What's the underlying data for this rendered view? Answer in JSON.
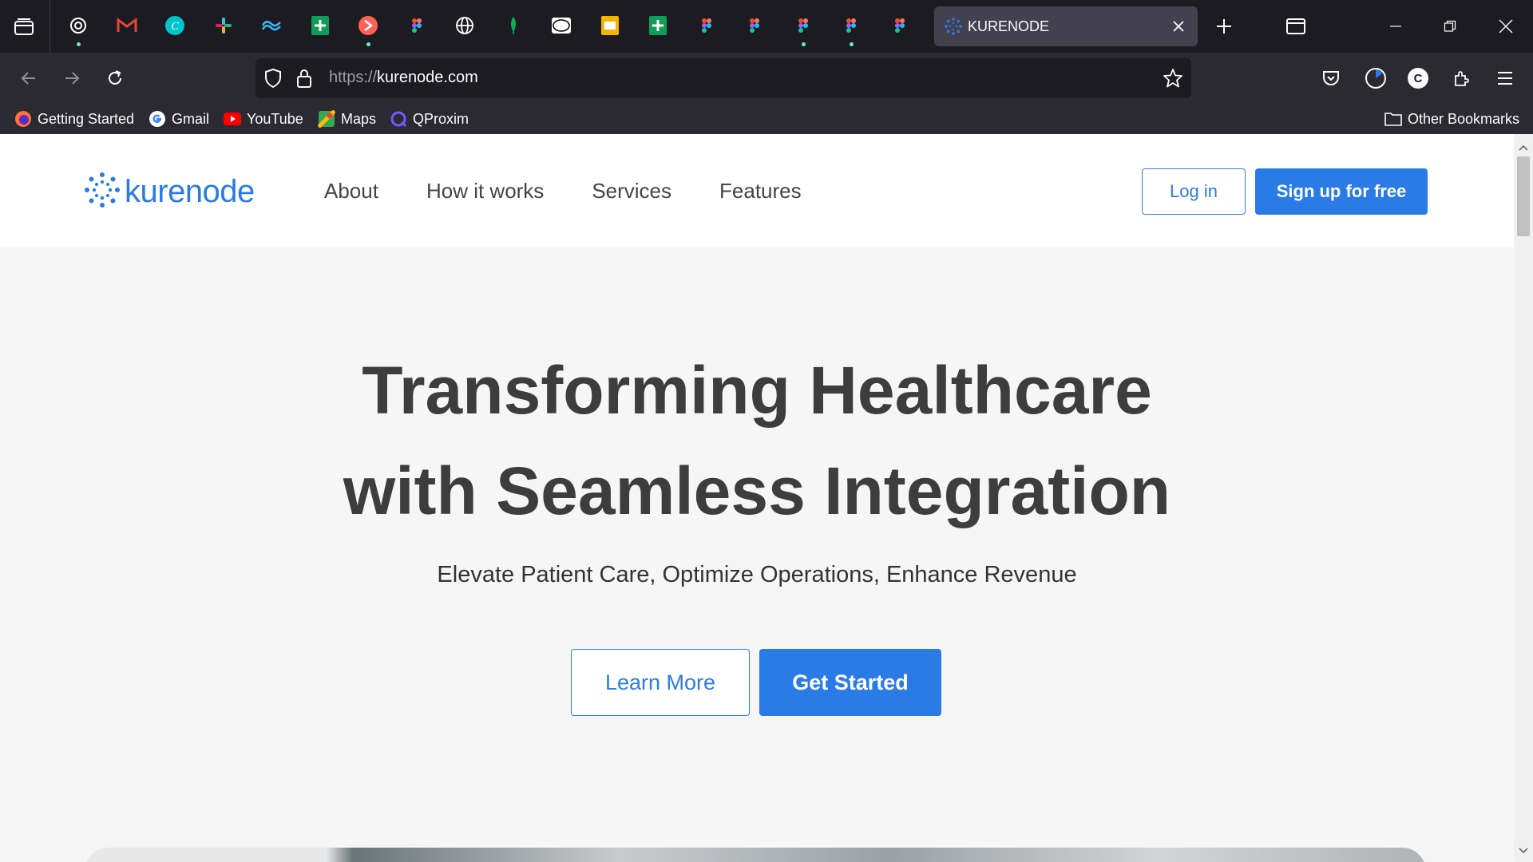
{
  "browser": {
    "active_tab": {
      "title": "KURENODE",
      "icon": "kurenode-icon",
      "close_icon": "close-icon"
    },
    "pinned_tabs": [
      {
        "icon": "openai-icon",
        "color": "#ffffff",
        "has_dot": true
      },
      {
        "icon": "gmail-icon",
        "color": "#ea4335",
        "has_dot": false
      },
      {
        "icon": "canva-icon",
        "color": "#00c4cc",
        "has_dot": false
      },
      {
        "icon": "slack-icon",
        "color": "#e01e5a",
        "has_dot": false
      },
      {
        "icon": "tailwind-icon",
        "color": "#38bdf8",
        "has_dot": false
      },
      {
        "icon": "google-sheets-icon",
        "color": "#0f9d58",
        "has_dot": false
      },
      {
        "icon": "producthunt-icon",
        "color": "#ff6154",
        "has_dot": true
      },
      {
        "icon": "figma-icon",
        "color": "#a259ff",
        "has_dot": false
      },
      {
        "icon": "globe-icon",
        "color": "#ffffff",
        "has_dot": false
      },
      {
        "icon": "mongodb-icon",
        "color": "#13aa52",
        "has_dot": false
      },
      {
        "icon": "mtn-icon",
        "color": "#ffffff",
        "has_dot": false
      },
      {
        "icon": "google-slides-icon",
        "color": "#f4b400",
        "has_dot": false
      },
      {
        "icon": "google-sheets-icon",
        "color": "#0f9d58",
        "has_dot": false
      },
      {
        "icon": "figma-icon",
        "color": "#a259ff",
        "has_dot": false
      },
      {
        "icon": "figma-icon",
        "color": "#a259ff",
        "has_dot": false
      },
      {
        "icon": "figma-icon",
        "color": "#a259ff",
        "has_dot": true
      },
      {
        "icon": "figma-icon",
        "color": "#a259ff",
        "has_dot": true
      },
      {
        "icon": "figma-icon",
        "color": "#a259ff",
        "has_dot": false
      }
    ],
    "address_bar": {
      "protocol": "https://",
      "domain": "kurenode.com"
    },
    "bookmarks": [
      {
        "label": "Getting Started",
        "icon": "firefox-icon"
      },
      {
        "label": "Gmail",
        "icon": "google-icon"
      },
      {
        "label": "YouTube",
        "icon": "youtube-icon"
      },
      {
        "label": "Maps",
        "icon": "maps-icon"
      },
      {
        "label": "QProxim",
        "icon": "qproxim-icon"
      }
    ],
    "other_bookmarks": "Other Bookmarks",
    "account_initial": "C"
  },
  "site": {
    "logo_text": "kurenode",
    "nav": [
      "About",
      "How it works",
      "Services",
      "Features"
    ],
    "login_label": "Log in",
    "signup_label": "Sign up for free",
    "hero": {
      "title_line1": "Transforming Healthcare",
      "title_line2": "with Seamless Integration",
      "subtitle": "Elevate Patient Care, Optimize Operations, Enhance Revenue",
      "learn_more": "Learn More",
      "get_started": "Get Started"
    },
    "colors": {
      "brand": "#2b7be6",
      "text": "#3d3d3d",
      "background": "#f6f6f6"
    }
  }
}
